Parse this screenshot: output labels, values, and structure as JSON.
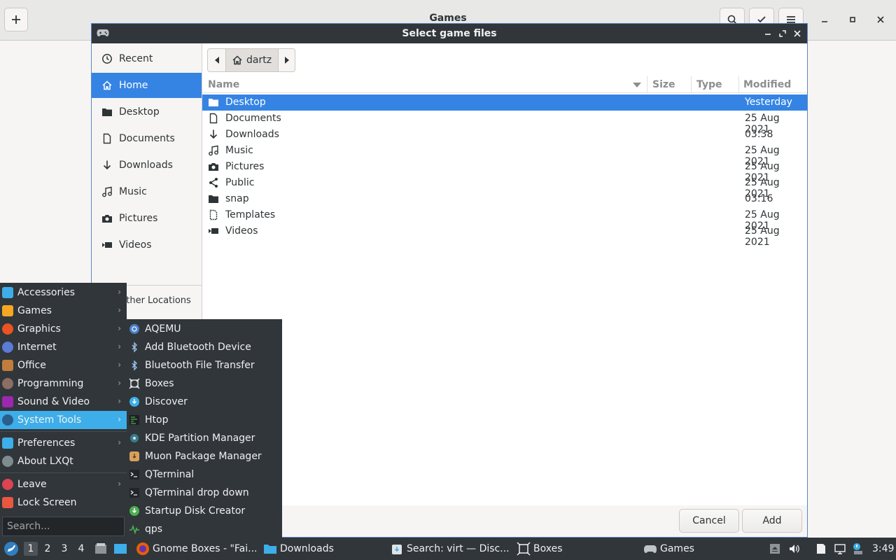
{
  "background_app": {
    "title": "Games"
  },
  "dialog": {
    "title": "Select game files",
    "pathbar": {
      "current": "dartz"
    },
    "sidebar": [
      {
        "label": "Recent",
        "icon": "clock-icon"
      },
      {
        "label": "Home",
        "icon": "home-icon",
        "selected": true
      },
      {
        "label": "Desktop",
        "icon": "folder-icon"
      },
      {
        "label": "Documents",
        "icon": "document-icon"
      },
      {
        "label": "Downloads",
        "icon": "download-icon"
      },
      {
        "label": "Music",
        "icon": "music-icon"
      },
      {
        "label": "Pictures",
        "icon": "camera-icon"
      },
      {
        "label": "Videos",
        "icon": "video-icon"
      },
      {
        "label": "Other Locations",
        "icon": "plus-icon"
      }
    ],
    "columns": {
      "name": "Name",
      "size": "Size",
      "type": "Type",
      "modified": "Modified"
    },
    "files": [
      {
        "name": "Desktop",
        "modified": "Yesterday",
        "icon": "folder-icon",
        "selected": true
      },
      {
        "name": "Documents",
        "modified": "25 Aug 2021",
        "icon": "document-icon"
      },
      {
        "name": "Downloads",
        "modified": "03:38",
        "icon": "download-icon"
      },
      {
        "name": "Music",
        "modified": "25 Aug 2021",
        "icon": "music-icon"
      },
      {
        "name": "Pictures",
        "modified": "25 Aug 2021",
        "icon": "camera-icon"
      },
      {
        "name": "Public",
        "modified": "25 Aug 2021",
        "icon": "share-icon"
      },
      {
        "name": "snap",
        "modified": "03:16",
        "icon": "folder-icon"
      },
      {
        "name": "Templates",
        "modified": "25 Aug 2021",
        "icon": "template-icon"
      },
      {
        "name": "Videos",
        "modified": "25 Aug 2021",
        "icon": "video-icon"
      }
    ],
    "buttons": {
      "cancel": "Cancel",
      "add": "Add"
    }
  },
  "main_menu": {
    "items": [
      {
        "label": "Accessories",
        "icon": "accessories-icon",
        "color": "#3daee9",
        "submenu": true
      },
      {
        "label": "Games",
        "icon": "games-icon",
        "color": "#f5a623",
        "submenu": true
      },
      {
        "label": "Graphics",
        "icon": "graphics-icon",
        "color": "#e95420",
        "submenu": true
      },
      {
        "label": "Internet",
        "icon": "internet-icon",
        "color": "#5b7bd5",
        "submenu": true
      },
      {
        "label": "Office",
        "icon": "office-icon",
        "color": "#c17d3c",
        "submenu": true
      },
      {
        "label": "Programming",
        "icon": "programming-icon",
        "color": "#8d6e63",
        "submenu": true
      },
      {
        "label": "Sound & Video",
        "icon": "sound-video-icon",
        "color": "#9c27b0",
        "submenu": true
      },
      {
        "label": "System Tools",
        "icon": "system-tools-icon",
        "color": "#4a90d9",
        "submenu": true,
        "highlighted": true
      },
      {
        "label": "Preferences",
        "icon": "preferences-icon",
        "color": "#3daee9",
        "submenu": true
      },
      {
        "label": "About LXQt",
        "icon": "info-icon",
        "color": "#7f8c8d",
        "submenu": false
      },
      {
        "label": "Leave",
        "icon": "power-icon",
        "color": "#da4453",
        "submenu": true
      },
      {
        "label": "Lock Screen",
        "icon": "lock-icon",
        "color": "#e9573f",
        "submenu": false
      }
    ],
    "search_placeholder": "Search..."
  },
  "system_tools_menu": [
    {
      "label": "AQEMU",
      "icon": "aqemu-icon"
    },
    {
      "label": "Add Bluetooth Device",
      "icon": "bluetooth-icon"
    },
    {
      "label": "Bluetooth File Transfer",
      "icon": "bluetooth-icon"
    },
    {
      "label": "Boxes",
      "icon": "boxes-icon"
    },
    {
      "label": "Discover",
      "icon": "discover-icon"
    },
    {
      "label": "Htop",
      "icon": "htop-icon"
    },
    {
      "label": "KDE Partition Manager",
      "icon": "partition-icon"
    },
    {
      "label": "Muon Package Manager",
      "icon": "package-icon"
    },
    {
      "label": "QTerminal",
      "icon": "terminal-icon"
    },
    {
      "label": "QTerminal drop down",
      "icon": "terminal-icon"
    },
    {
      "label": "Startup Disk Creator",
      "icon": "disk-creator-icon"
    },
    {
      "label": "qps",
      "icon": "qps-icon"
    }
  ],
  "taskbar": {
    "workspaces": [
      "1",
      "2",
      "3",
      "4"
    ],
    "tasks": [
      {
        "label": "Gnome Boxes - \"Fai...",
        "icon": "firefox-icon"
      },
      {
        "label": "Downloads",
        "icon": "folder-icon"
      },
      {
        "label": "Search: virt — Disc...",
        "icon": "discover-icon"
      },
      {
        "label": "Boxes",
        "icon": "boxes-icon"
      },
      {
        "label": "Games",
        "icon": "games-icon"
      }
    ],
    "clock": "3:49"
  }
}
